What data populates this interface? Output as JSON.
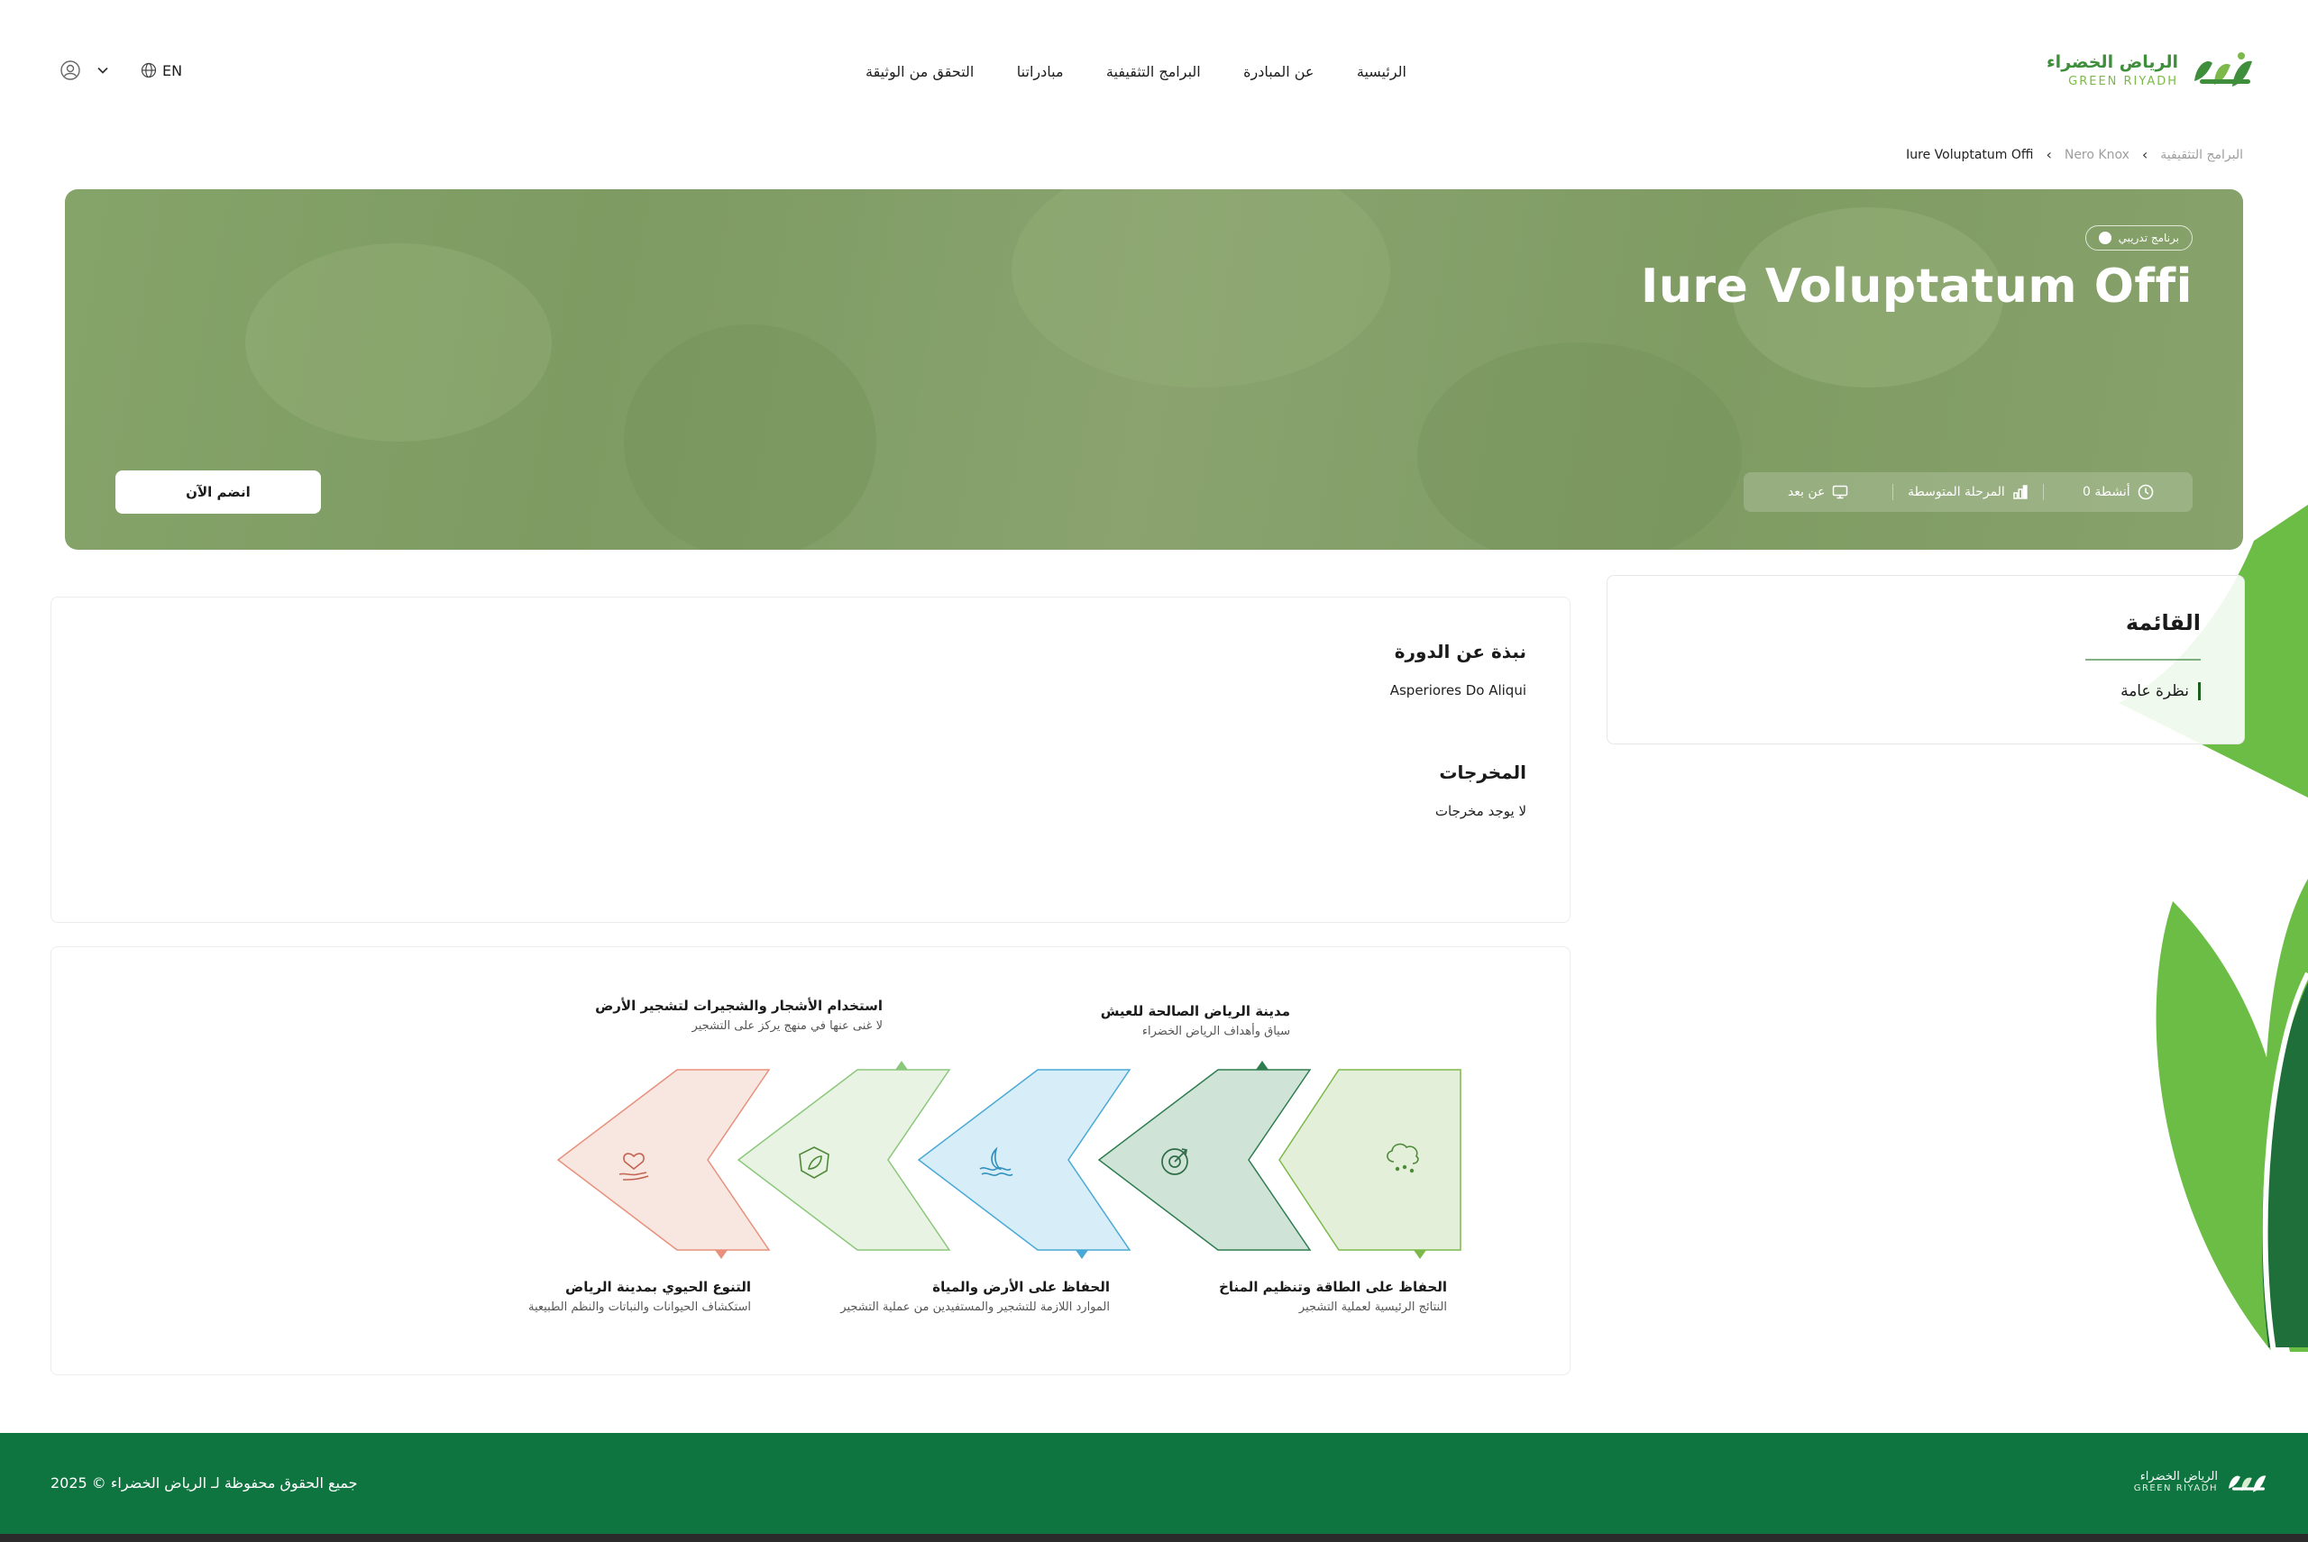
{
  "brand": {
    "name_ar": "الرياض الخضراء",
    "name_en": "GREEN RIYADH"
  },
  "nav": {
    "items": [
      {
        "label": "الرئيسية"
      },
      {
        "label": "عن المبادرة"
      },
      {
        "label": "البرامج التثقيفية"
      },
      {
        "label": "مبادراتنا"
      },
      {
        "label": "التحقق من الوثيقة"
      }
    ]
  },
  "header": {
    "lang_label": "EN"
  },
  "breadcrumb": {
    "items": [
      "البرامج التثقيفية",
      "Nero Knox",
      "Iure Voluptatum Offi"
    ]
  },
  "hero": {
    "badge": "برنامج تدريبي",
    "title": "Iure Voluptatum Offi",
    "join_label": "انضم الآن",
    "stats": [
      {
        "icon": "clock-icon",
        "label": "0 أنشطة"
      },
      {
        "icon": "bar-chart-icon",
        "label": "المرحلة المتوسطة"
      },
      {
        "icon": "monitor-icon",
        "label": "عن بعد"
      }
    ]
  },
  "sidebar": {
    "title": "القائمة",
    "items": [
      {
        "label": "نظرة عامة"
      }
    ]
  },
  "about": {
    "heading": "نبذة عن الدورة",
    "text": "Asperiores Do Aliqui",
    "outputs_heading": "المخرجات",
    "outputs_text": "لا يوجد مخرجات"
  },
  "pathway": {
    "steps": [
      {
        "title": "الحفاظ على الطاقة وتنظيم المناخ",
        "subtitle": "النتائج الرئيسية لعملية التشجير",
        "icon": "cloud-rain-icon",
        "color": "#7cb94a",
        "fill": "#e3efd8"
      },
      {
        "title": "مدينة الرياض الصالحة للعيش",
        "subtitle": "سياق وأهداف الرياض الخضراء",
        "icon": "target-icon",
        "color": "#2e7d4f",
        "fill": "#cfe3d7"
      },
      {
        "title": "الحفاظ على الأرض والمياة",
        "subtitle": "الموارد اللازمة للتشجير والمستفيدين من عملية التشجير",
        "icon": "water-icon",
        "color": "#49a9d6",
        "fill": "#d7edf7"
      },
      {
        "title": "استخدام الأشجار والشجيرات لتشجير الأرض",
        "subtitle": "لا غنى عنها في منهج يركز على التشجير",
        "icon": "leaf-icon",
        "color": "#8bc77a",
        "fill": "#e8f3e3"
      },
      {
        "title": "التنوع الحيوي بمدينة الرياض",
        "subtitle": "استكشاف الحيوانات والنباتات والنظم الطبيعية",
        "icon": "hand-heart-icon",
        "color": "#e8907c",
        "fill": "#f8e6e1"
      }
    ]
  },
  "footer": {
    "copyright": "جميع الحقوق محفوظة لـ الرياض الخضراء © 2025",
    "brand_ar": "الرياض الخضراء",
    "brand_en": "GREEN RIYADH"
  }
}
